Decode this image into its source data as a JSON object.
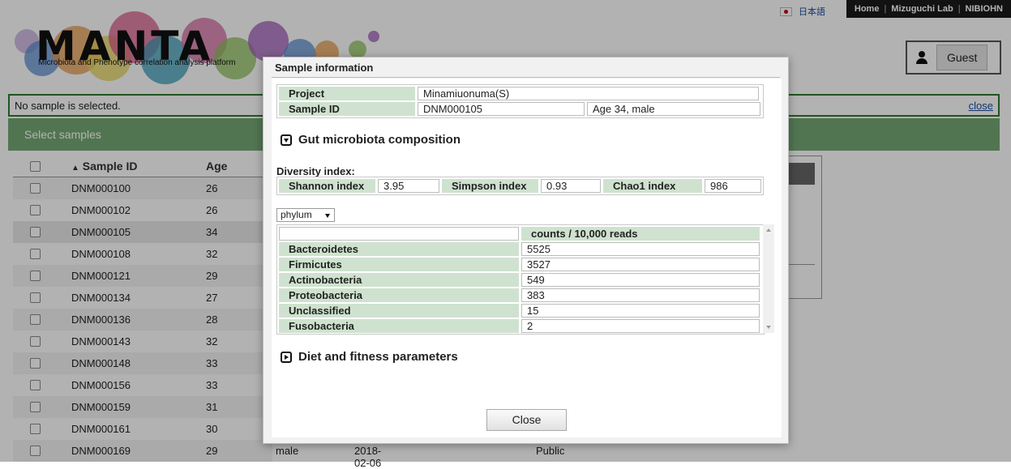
{
  "header": {
    "lang_link": "日本語",
    "nav": [
      "Home",
      "Mizuguchi Lab",
      "NIBIOHN"
    ],
    "logo_text": "MANTA",
    "logo_tagline": "Microbiota and Phenotype correlation analysis platform",
    "user_button": "Guest"
  },
  "notice": {
    "text": "No sample is selected.",
    "close_link": "close"
  },
  "select_bar": "Select samples",
  "table": {
    "headers": {
      "sample_id": "Sample ID",
      "age": "Age",
      "sort_indicator": "▲"
    },
    "rows": [
      {
        "id": "DNM000100",
        "age": "26"
      },
      {
        "id": "DNM000102",
        "age": "26"
      },
      {
        "id": "DNM000105",
        "age": "34"
      },
      {
        "id": "DNM000108",
        "age": "32"
      },
      {
        "id": "DNM000121",
        "age": "29"
      },
      {
        "id": "DNM000134",
        "age": "27"
      },
      {
        "id": "DNM000136",
        "age": "28"
      },
      {
        "id": "DNM000143",
        "age": "32"
      },
      {
        "id": "DNM000148",
        "age": "33"
      },
      {
        "id": "DNM000156",
        "age": "33"
      },
      {
        "id": "DNM000159",
        "age": "31"
      },
      {
        "id": "DNM000161",
        "age": "30"
      },
      {
        "id": "DNM000169",
        "age": "29"
      }
    ],
    "last_row_extra": {
      "sex": "male",
      "date": "2018-02-06",
      "status": "Public"
    }
  },
  "modal": {
    "title": "Sample information",
    "project_label": "Project",
    "project_value": "Minamiuonuma(S)",
    "sample_label": "Sample ID",
    "sample_value": "DNM000105",
    "sample_extra": "Age 34, male",
    "gut_section": "Gut microbiota composition",
    "diversity_label": "Diversity index:",
    "diversity": {
      "shannon_label": "Shannon index",
      "shannon_value": "3.95",
      "simpson_label": "Simpson index",
      "simpson_value": "0.93",
      "chao1_label": "Chao1 index",
      "chao1_value": "986"
    },
    "level_select": "phylum",
    "counts_header": "counts / 10,000 reads",
    "taxa": [
      {
        "name": "Bacteroidetes",
        "count": "5525"
      },
      {
        "name": "Firmicutes",
        "count": "3527"
      },
      {
        "name": "Actinobacteria",
        "count": "549"
      },
      {
        "name": "Proteobacteria",
        "count": "383"
      },
      {
        "name": "Unclassified",
        "count": "15"
      },
      {
        "name": "Fusobacteria",
        "count": "2"
      }
    ],
    "diet_section": "Diet and fitness parameters",
    "close_button": "Close"
  }
}
